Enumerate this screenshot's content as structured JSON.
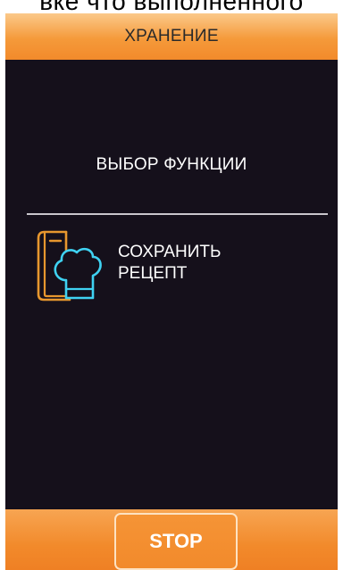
{
  "caption": {
    "text": "вке  что выполненного"
  },
  "header": {
    "title": "ХРАНЕНИЕ"
  },
  "main": {
    "section_title": "ВЫБОР ФУНКЦИИ",
    "items": [
      {
        "icon": "recipe-book-chef-hat-icon",
        "label_line1": "СОХРАНИТЬ",
        "label_line2": "РЕЦЕПТ"
      }
    ]
  },
  "footer": {
    "stop_label": "STOP"
  },
  "colors": {
    "accent_orange": "#f28a2b",
    "screen_background": "#15101b",
    "icon_orange": "#e7972e",
    "icon_cyan": "#3fd2f2",
    "text_white": "#ffffff"
  }
}
